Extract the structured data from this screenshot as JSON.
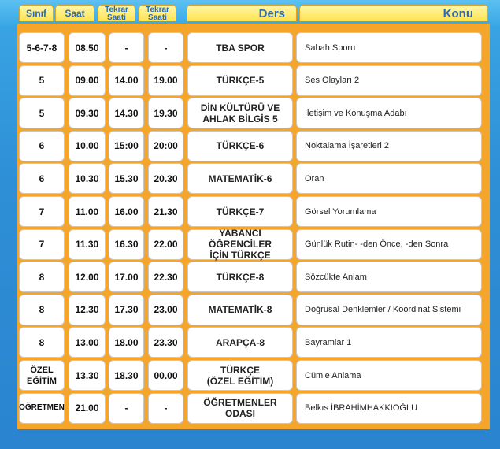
{
  "headers": {
    "sinif": "Sınıf",
    "saat": "Saat",
    "tekrar1": [
      "Tekrar",
      "Saati"
    ],
    "tekrar2": [
      "Tekrar",
      "Saati"
    ],
    "ders": "Ders",
    "konu": "Konu"
  },
  "rows": [
    {
      "sinif": "5-6-7-8",
      "saat": "08.50",
      "tekrar1": "-",
      "tekrar2": "-",
      "ders": [
        "TBA SPOR"
      ],
      "konu": "Sabah Sporu"
    },
    {
      "sinif": "5",
      "saat": "09.00",
      "tekrar1": "14.00",
      "tekrar2": "19.00",
      "ders": [
        "TÜRKÇE-5"
      ],
      "konu": "Ses Olayları 2"
    },
    {
      "sinif": "5",
      "saat": "09.30",
      "tekrar1": "14.30",
      "tekrar2": "19.30",
      "ders": [
        "DİN KÜLTÜRÜ VE",
        "AHLAK BİLGİS 5"
      ],
      "konu": "İletişim ve Konuşma Adabı"
    },
    {
      "sinif": "6",
      "saat": "10.00",
      "tekrar1": "15:00",
      "tekrar2": "20:00",
      "ders": [
        "TÜRKÇE-6"
      ],
      "konu": "Noktalama İşaretleri 2"
    },
    {
      "sinif": "6",
      "saat": "10.30",
      "tekrar1": "15.30",
      "tekrar2": "20.30",
      "ders": [
        "MATEMATİK-6"
      ],
      "konu": "Oran"
    },
    {
      "sinif": "7",
      "saat": "11.00",
      "tekrar1": "16.00",
      "tekrar2": "21.30",
      "ders": [
        "TÜRKÇE-7"
      ],
      "konu": "Görsel Yorumlama"
    },
    {
      "sinif": "7",
      "saat": "11.30",
      "tekrar1": "16.30",
      "tekrar2": "22.00",
      "ders": [
        "YABANCI ÖĞRENCİLER",
        "İÇİN TÜRKÇE"
      ],
      "konu": "Günlük Rutin- -den Önce, -den Sonra"
    },
    {
      "sinif": "8",
      "saat": "12.00",
      "tekrar1": "17.00",
      "tekrar2": "22.30",
      "ders": [
        "TÜRKÇE-8"
      ],
      "konu": "Sözcükte Anlam"
    },
    {
      "sinif": "8",
      "saat": "12.30",
      "tekrar1": "17.30",
      "tekrar2": "23.00",
      "ders": [
        "MATEMATİK-8"
      ],
      "konu": "Doğrusal Denklemler / Koordinat Sistemi"
    },
    {
      "sinif": "8",
      "saat": "13.00",
      "tekrar1": "18.00",
      "tekrar2": "23.30",
      "ders": [
        "ARAPÇA-8"
      ],
      "konu": "Bayramlar 1"
    },
    {
      "sinif": "ÖZEL EĞİTİM",
      "saat": "13.30",
      "tekrar1": "18.30",
      "tekrar2": "00.00",
      "ders": [
        "TÜRKÇE",
        "(ÖZEL EĞİTİM)"
      ],
      "konu": "Cümle Anlama"
    },
    {
      "sinif": "ÖĞRETMEN",
      "saat": "21.00",
      "tekrar1": "-",
      "tekrar2": "-",
      "ders": [
        "ÖĞRETMENLER",
        "ODASI"
      ],
      "konu": "Belkıs İBRAHİMHAKKIOĞLU"
    }
  ]
}
